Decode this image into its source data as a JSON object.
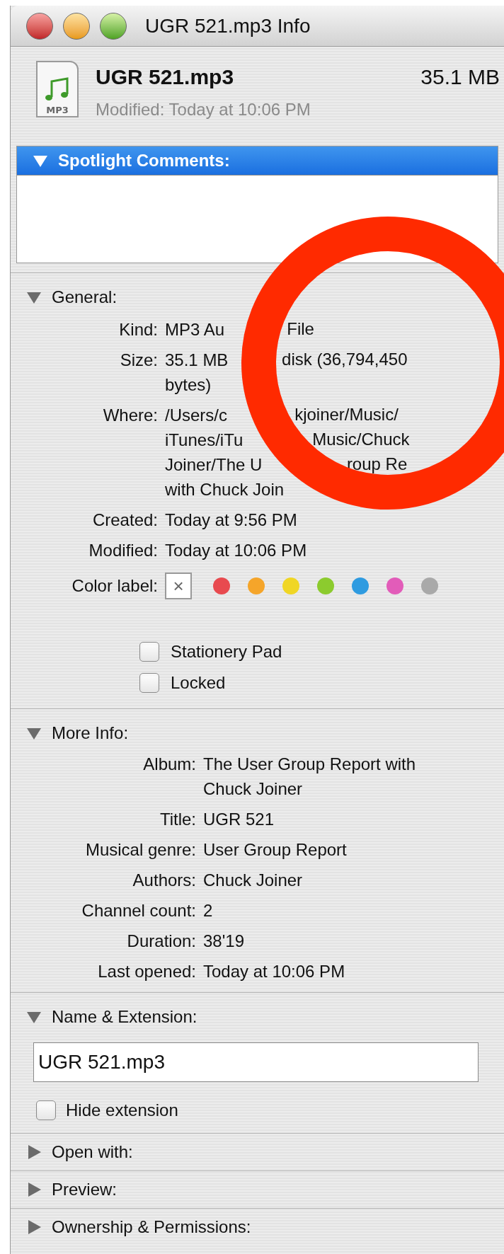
{
  "window": {
    "title": "UGR 521.mp3 Info"
  },
  "header": {
    "icon_label": "MP3",
    "name": "UGR 521.mp3",
    "size": "35.1 MB",
    "modified": "Modified: Today at 10:06 PM"
  },
  "spotlight": {
    "label": "Spotlight Comments:",
    "expanded": true,
    "selected": true
  },
  "general": {
    "label": "General:",
    "expanded": true,
    "rows": [
      {
        "label": "Kind:",
        "lines": [
          [
            "MP3 Au",
            "File"
          ]
        ]
      },
      {
        "label": "Size:",
        "lines": [
          [
            "35.1 MB",
            "disk (36,794,450"
          ],
          [
            "bytes)"
          ]
        ]
      },
      {
        "label": "Where:",
        "lines": [
          [
            "/Users/c",
            "kjoiner/Music/"
          ],
          [
            "iTunes/iTu",
            "Music/Chuck"
          ],
          [
            "Joiner/The U",
            "roup Re"
          ],
          [
            "with Chuck Join"
          ]
        ]
      },
      {
        "label": "Created:",
        "lines": [
          [
            "Today at 9:56 PM"
          ]
        ]
      },
      {
        "label": "Modified:",
        "lines": [
          [
            "Today at 10:06 PM"
          ]
        ]
      }
    ],
    "color_label": {
      "label": "Color label:",
      "none_symbol": "×",
      "none_selected": true,
      "colors": [
        {
          "color": "#e84a4f"
        },
        {
          "color": "#f5a52a"
        },
        {
          "color": "#f0d625"
        },
        {
          "color": "#8ccb2e"
        },
        {
          "color": "#2f9be0"
        },
        {
          "color": "#e25cb9"
        },
        {
          "color": "#a9a9a9"
        }
      ]
    },
    "checkboxes": [
      {
        "label": "Stationery Pad",
        "checked": false
      },
      {
        "label": "Locked",
        "checked": false
      }
    ]
  },
  "more_info": {
    "label": "More Info:",
    "expanded": true,
    "rows": [
      {
        "label": "Album:",
        "lines": [
          [
            "The User Group Report with"
          ],
          [
            "Chuck Joiner"
          ]
        ]
      },
      {
        "label": "Title:",
        "lines": [
          [
            "UGR 521"
          ]
        ]
      },
      {
        "label": "Musical genre:",
        "lines": [
          [
            "User Group Report"
          ]
        ]
      },
      {
        "label": "Authors:",
        "lines": [
          [
            "Chuck Joiner"
          ]
        ]
      },
      {
        "label": "Channel count:",
        "lines": [
          [
            "2"
          ]
        ]
      },
      {
        "label": "Duration:",
        "lines": [
          [
            "38'19"
          ]
        ]
      },
      {
        "label": "Last opened:",
        "lines": [
          [
            "Today at 10:06 PM"
          ]
        ]
      }
    ]
  },
  "name_extension": {
    "label": "Name & Extension:",
    "expanded": true,
    "value": "UGR 521.mp3",
    "hide_extension": {
      "label": "Hide extension",
      "checked": false
    }
  },
  "collapsed_sections": [
    {
      "label": "Open with:",
      "expanded": false
    },
    {
      "label": "Preview:",
      "expanded": false
    },
    {
      "label": "Ownership & Permissions:",
      "expanded": false
    }
  ],
  "annotation": {
    "kind": "circle"
  }
}
